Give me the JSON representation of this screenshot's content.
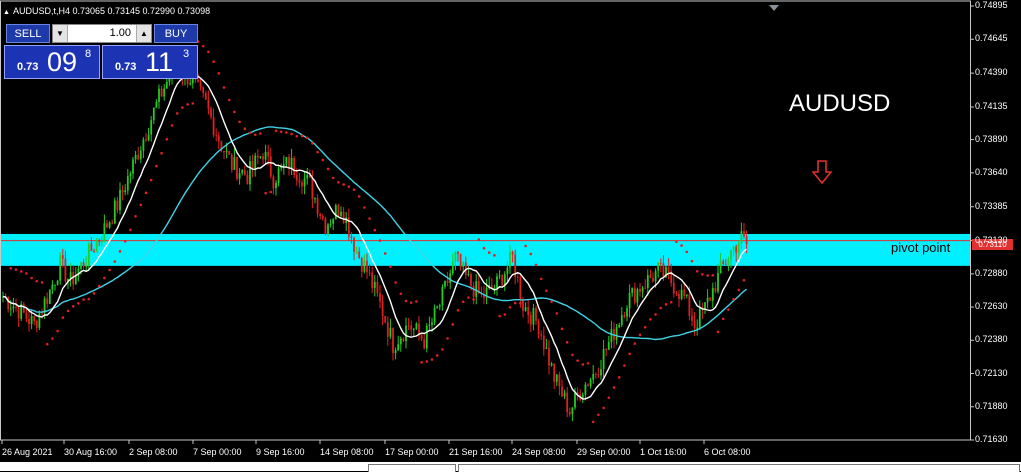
{
  "window": {
    "symbol_header": "AUDUSD,t,H4  0.73065 0.73145 0.72990 0.73098"
  },
  "trade_panel": {
    "sell_label": "SELL",
    "buy_label": "BUY",
    "lot_value": "1.00",
    "bid": {
      "prefix": "0.73",
      "big": "09",
      "sup": "8"
    },
    "ask": {
      "prefix": "0.73",
      "big": "11",
      "sup": "3"
    }
  },
  "annotations": {
    "title": "AUDUSD",
    "pivot_label": "pivot point",
    "price_tag": "0.73110",
    "arrow_color": "#e03030",
    "arrow_icon": "down-arrow-icon"
  },
  "colors": {
    "background": "#000000",
    "bull_candle": "#22cc22",
    "bear_candle": "#e02020",
    "sma_fast": "#ffffff",
    "sma_slow": "#3fd3e6",
    "parabolic_sar": "#e02020",
    "pivot_zone": "#00f0ff",
    "pivot_line": "#e03030"
  },
  "chart_data": {
    "type": "candlestick",
    "symbol": "AUDUSD",
    "timeframe": "H4",
    "ylim": [
      0.7163,
      0.7491
    ],
    "y_ticks": [
      "0.74895",
      "0.74645",
      "0.74390",
      "0.74135",
      "0.73890",
      "0.73640",
      "0.73385",
      "0.73130",
      "0.72880",
      "0.72630",
      "0.72380",
      "0.72130",
      "0.71880",
      "0.71630"
    ],
    "x_ticks": [
      "26 Aug 2021",
      "30 Aug 16:00",
      "2 Sep 08:00",
      "7 Sep 00:00",
      "9 Sep 16:00",
      "14 Sep 08:00",
      "17 Sep 00:00",
      "21 Sep 16:00",
      "24 Sep 08:00",
      "29 Sep 00:00",
      "1 Oct 16:00",
      "6 Oct 08:00"
    ],
    "pivot_zone": [
      0.7294,
      0.7318
    ],
    "pivot_level": 0.7313,
    "close_path": [
      [
        0,
        0.7271
      ],
      [
        6,
        0.7261
      ],
      [
        12,
        0.725
      ],
      [
        18,
        0.7275
      ],
      [
        22,
        0.7295
      ],
      [
        26,
        0.7282
      ],
      [
        32,
        0.73
      ],
      [
        38,
        0.7318
      ],
      [
        44,
        0.734
      ],
      [
        52,
        0.738
      ],
      [
        60,
        0.742
      ],
      [
        66,
        0.7445
      ],
      [
        72,
        0.7435
      ],
      [
        78,
        0.7415
      ],
      [
        84,
        0.7385
      ],
      [
        88,
        0.737
      ],
      [
        94,
        0.7362
      ],
      [
        100,
        0.738
      ],
      [
        104,
        0.736
      ],
      [
        110,
        0.7372
      ],
      [
        118,
        0.7355
      ],
      [
        124,
        0.7325
      ],
      [
        130,
        0.734
      ],
      [
        136,
        0.7305
      ],
      [
        140,
        0.729
      ],
      [
        146,
        0.726
      ],
      [
        150,
        0.7235
      ],
      [
        156,
        0.725
      ],
      [
        162,
        0.7238
      ],
      [
        168,
        0.7265
      ],
      [
        174,
        0.73
      ],
      [
        178,
        0.7285
      ],
      [
        184,
        0.727
      ],
      [
        190,
        0.728
      ],
      [
        196,
        0.73
      ],
      [
        200,
        0.7265
      ],
      [
        206,
        0.725
      ],
      [
        212,
        0.721
      ],
      [
        218,
        0.7185
      ],
      [
        222,
        0.72
      ],
      [
        228,
        0.7215
      ],
      [
        234,
        0.724
      ],
      [
        240,
        0.7268
      ],
      [
        246,
        0.728
      ],
      [
        252,
        0.729
      ],
      [
        256,
        0.7285
      ],
      [
        262,
        0.727
      ],
      [
        266,
        0.725
      ],
      [
        270,
        0.7262
      ],
      [
        276,
        0.729
      ],
      [
        280,
        0.7305
      ],
      [
        284,
        0.7315
      ],
      [
        286,
        0.731
      ]
    ],
    "n_bars": 287
  }
}
